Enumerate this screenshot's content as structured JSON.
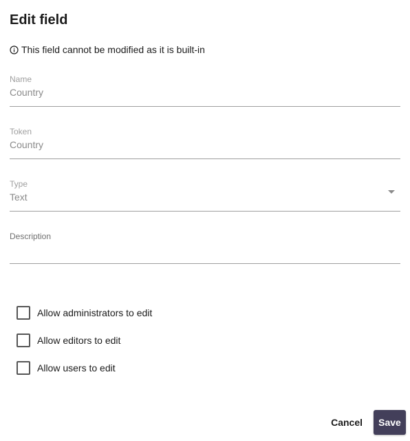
{
  "dialog": {
    "title": "Edit field",
    "notice": "This field cannot be modified as it is built-in",
    "notice_icon": "info-circle-icon"
  },
  "fields": {
    "name": {
      "label": "Name",
      "value": "Country"
    },
    "token": {
      "label": "Token",
      "value": "Country"
    },
    "type": {
      "label": "Type",
      "value": "Text"
    },
    "description": {
      "label": "Description",
      "value": ""
    }
  },
  "permissions": {
    "administrators": {
      "label": "Allow administrators to edit",
      "checked": false
    },
    "editors": {
      "label": "Allow editors to edit",
      "checked": false
    },
    "users": {
      "label": "Allow users to edit",
      "checked": false
    }
  },
  "actions": {
    "cancel_label": "Cancel",
    "save_label": "Save"
  },
  "colors": {
    "save_bg": "#433f5a",
    "underline": "#9e9e9e"
  }
}
